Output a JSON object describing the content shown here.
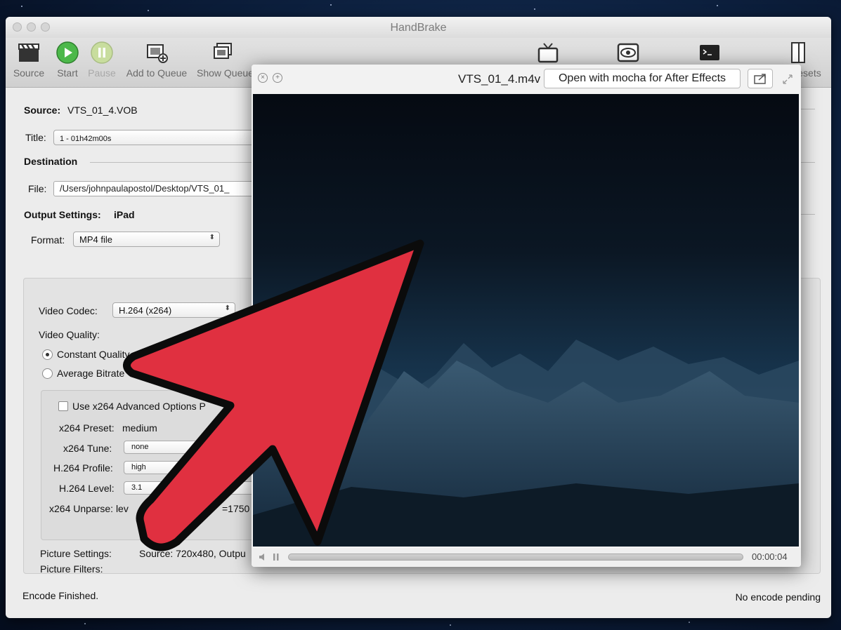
{
  "window": {
    "title": "HandBrake"
  },
  "toolbar": {
    "items": [
      {
        "label": "Source",
        "icon": "clapper-icon"
      },
      {
        "label": "Start",
        "icon": "play-icon"
      },
      {
        "label": "Pause",
        "icon": "pause-icon"
      },
      {
        "label": "Add to Queue",
        "icon": "add-queue-icon"
      },
      {
        "label": "Show Queue",
        "icon": "show-queue-icon"
      },
      {
        "label": "",
        "icon": "tv-icon"
      },
      {
        "label": "",
        "icon": "eye-icon"
      },
      {
        "label": "",
        "icon": "terminal-icon"
      },
      {
        "label": "esets",
        "icon": "presets-icon"
      }
    ]
  },
  "source": {
    "label": "Source:",
    "value": "VTS_01_4.VOB"
  },
  "title_row": {
    "label": "Title:",
    "value": "1 - 01h42m00s"
  },
  "destination": {
    "heading": "Destination",
    "file_label": "File:",
    "file_value": "/Users/johnpaulapostol/Desktop/VTS_01_"
  },
  "output": {
    "label": "Output Settings:",
    "preset": "iPad",
    "format_label": "Format:",
    "format_value": "MP4 file"
  },
  "video": {
    "codec_label": "Video Codec:",
    "codec_value": "H.264 (x264)",
    "quality_label": "Video Quality:",
    "constant_quality": "Constant Quality",
    "average_bitrate": "Average Bitrate",
    "advanced_label": "Use x264 Advanced Options P",
    "preset_label": "x264 Preset:",
    "preset_value": "medium",
    "tune_label": "x264 Tune:",
    "tune_value": "none",
    "profile_label": "H.264 Profile:",
    "profile_value": "high",
    "level_label": "H.264 Level:",
    "level_value": "3.1",
    "unparse_label": "x264 Unparse: lev",
    "unparse_tail": "=1750"
  },
  "picture": {
    "settings_label": "Picture Settings:",
    "settings_value": "Source: 720x480, Outpu",
    "filters_label": "Picture Filters:"
  },
  "status": {
    "left": "Encode Finished.",
    "right": "No encode pending"
  },
  "player": {
    "filename": "VTS_01_4.m4v",
    "open_button": "Open with mocha for After Effects",
    "timecode": "00:00:04"
  },
  "colors": {
    "arrow_red": "#e03040",
    "start_green": "#4cb84a"
  }
}
